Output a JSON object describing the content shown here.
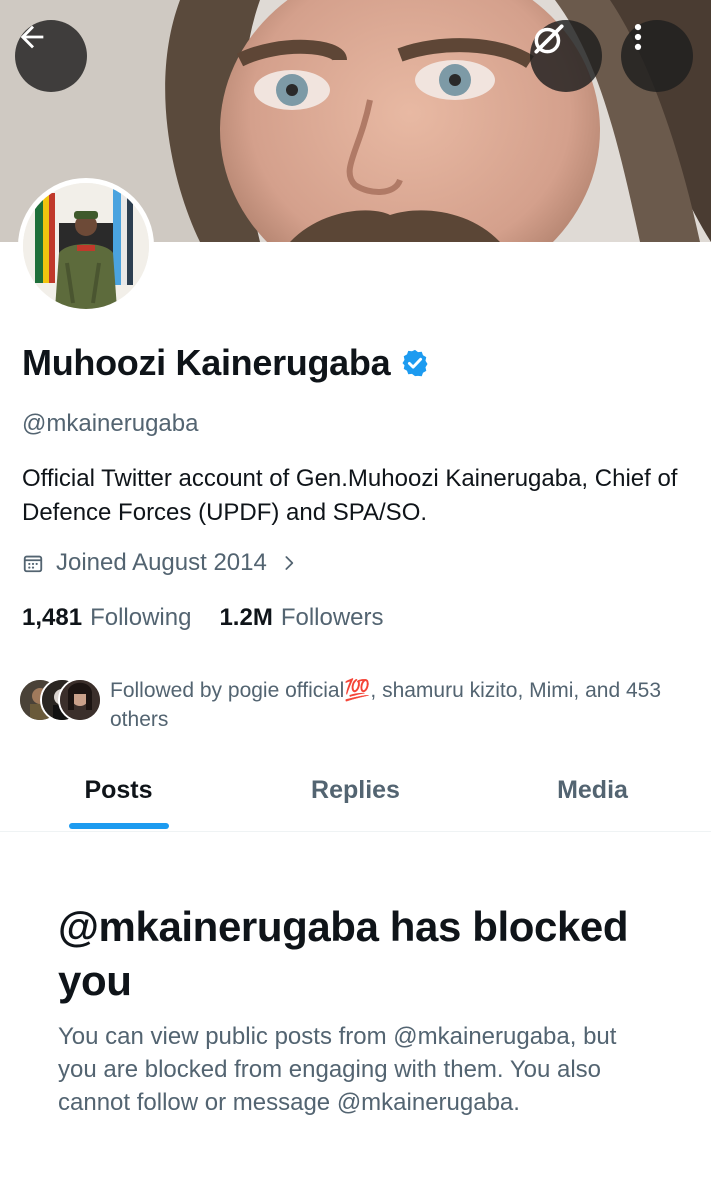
{
  "header": {
    "back_icon": "arrow-left-icon",
    "grok_icon": "grok-icon",
    "more_icon": "more-vertical-icon"
  },
  "profile": {
    "name": "Muhoozi Kainerugaba",
    "verified": true,
    "handle": "@mkainerugaba",
    "bio": "Official Twitter account of Gen.Muhoozi Kainerugaba, Chief of Defence Forces (UPDF) and SPA/SO.",
    "joined": "Joined August 2014",
    "following_count": "1,481",
    "following_label": "Following",
    "followers_count": "1.2M",
    "followers_label": "Followers",
    "followed_by": "Followed by pogie official💯, shamuru kizito, Mimi, and 453 others"
  },
  "tabs": [
    {
      "label": "Posts",
      "active": true
    },
    {
      "label": "Replies",
      "active": false
    },
    {
      "label": "Media",
      "active": false
    }
  ],
  "blocked": {
    "title": "@mkainerugaba has blocked you",
    "body": "You can view public posts from @mkainerugaba, but you are blocked from engaging with them. You also cannot follow or message @mkainerugaba."
  },
  "colors": {
    "accent": "#1d9bf0",
    "text_primary": "#0f1419",
    "text_secondary": "#536471"
  }
}
